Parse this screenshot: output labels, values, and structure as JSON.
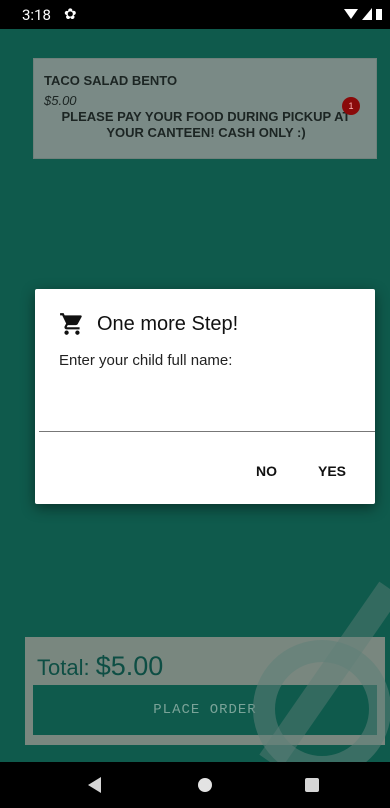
{
  "status_bar": {
    "time": "3:18"
  },
  "order": {
    "item_name": "TACO SALAD BENTO",
    "item_price": "$5.00",
    "note_line1": "PLEASE PAY YOUR FOOD DURING PICKUP AT",
    "note_line2": "YOUR CANTEEN! CASH ONLY :)",
    "quantity": "1"
  },
  "footer": {
    "total_label": "Total: ",
    "total_amount": "$5.00",
    "place_order_label": "PLACE ORDER"
  },
  "dialog": {
    "title": "One more Step!",
    "message": "Enter your child full name:",
    "input_value": "",
    "no_label": "NO",
    "yes_label": "YES"
  },
  "colors": {
    "app_background": "#0f5a4c",
    "badge": "#8a0a0a"
  }
}
